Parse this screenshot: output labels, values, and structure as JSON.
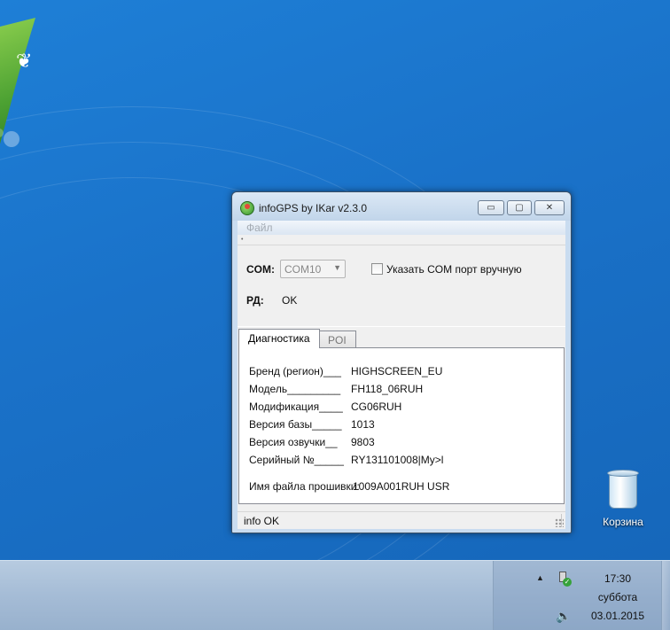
{
  "window": {
    "title": "infoGPS  by IKar v2.3.0",
    "controls": {
      "minimize": "▭",
      "maximize": "▢",
      "close": "✕"
    }
  },
  "menu": {
    "file": "Файл"
  },
  "com": {
    "label": "COM:",
    "selected": "COM10",
    "manual_label": "Указать COM  порт вручную"
  },
  "rd": {
    "label": "РД:",
    "value": "OK"
  },
  "tabs": [
    {
      "label": "Диагностика"
    },
    {
      "label": "POI"
    }
  ],
  "diagnostics": {
    "rows": [
      {
        "label": "Бренд (регион)___",
        "value": "HIGHSCREEN_EU"
      },
      {
        "label": "Модель_________",
        "value": "FH118_06RUH"
      },
      {
        "label": "Модификация____",
        "value": "CG06RUH"
      },
      {
        "label": "Версия базы_____",
        "value": "1013"
      },
      {
        "label": "Версия озвучки__",
        "value": "9803"
      },
      {
        "label": "Серийный №_____",
        "value": "RY131101008|My>l"
      }
    ],
    "firmware_label": "Имя файла прошивки:",
    "firmware_value": "1009A001RUH  USR"
  },
  "status": {
    "text": "info OK"
  },
  "desktop": {
    "recycle_bin": "Корзина"
  },
  "taskbar": {
    "time": "17:30",
    "day": "суббота",
    "date": "03.01.2015"
  }
}
